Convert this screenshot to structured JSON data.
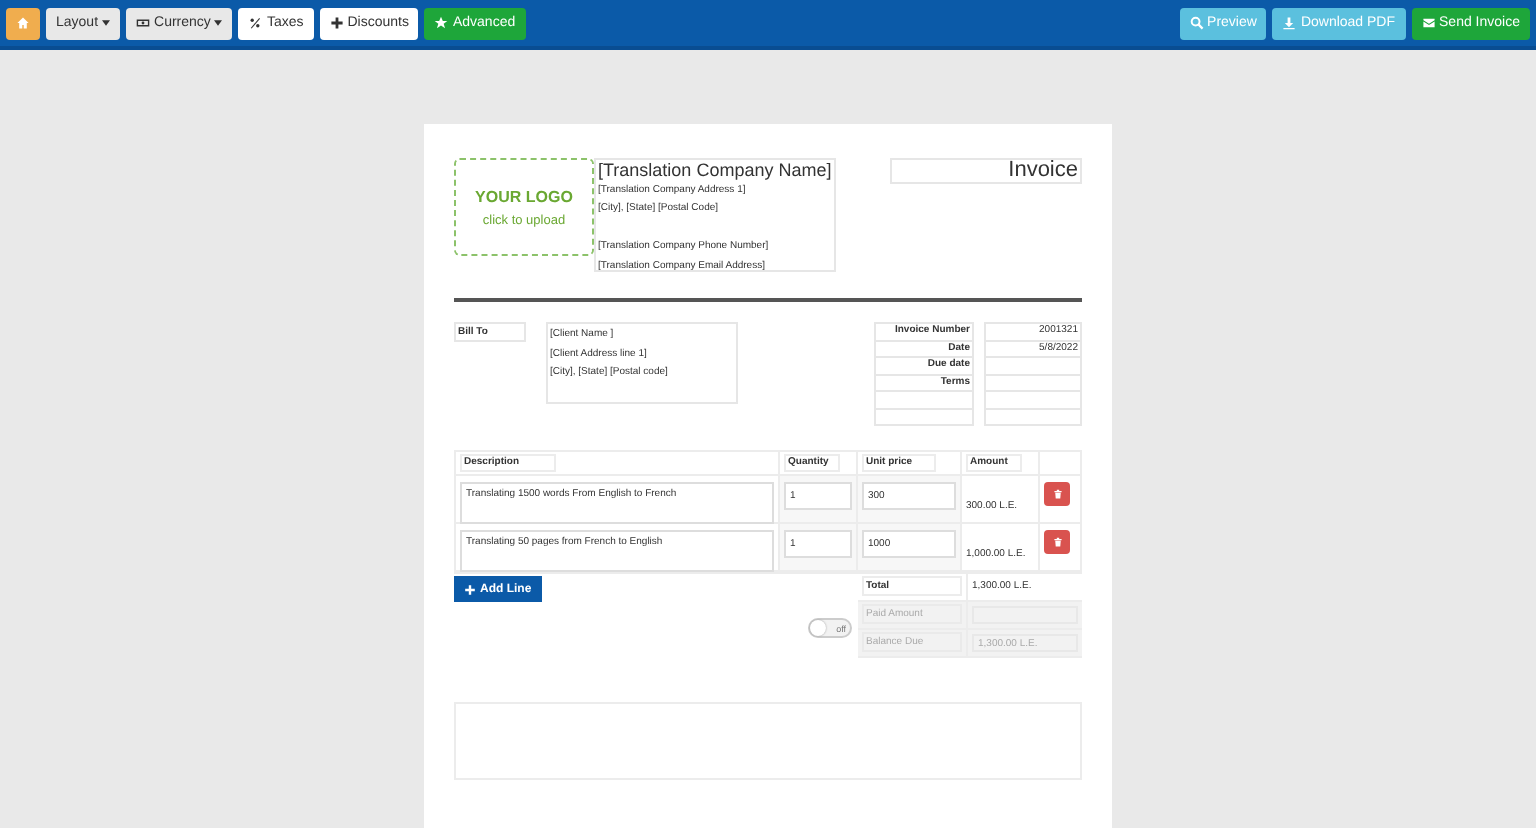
{
  "toolbar": {
    "left": [
      {
        "kind": "home"
      },
      {
        "kind": "layout",
        "label": "Layout"
      },
      {
        "kind": "currency",
        "label": "Currency"
      },
      {
        "kind": "taxes",
        "label": "Taxes"
      },
      {
        "kind": "discounts",
        "label": "Discounts"
      },
      {
        "kind": "advanced",
        "label": "Advanced"
      }
    ],
    "right": [
      {
        "kind": "preview",
        "label": "Preview"
      },
      {
        "kind": "download",
        "label": "Download PDF"
      },
      {
        "kind": "send",
        "label": "Send Invoice"
      }
    ]
  },
  "logo": {
    "title": "YOUR LOGO",
    "hint": "click to upload"
  },
  "company": {
    "name": "[Translation Company Name]",
    "address_lines": [
      "[Translation Company Address 1]",
      "[City], [State] [Postal Code]"
    ],
    "contact_lines": [
      "[Translation Company Phone Number]",
      "[Translation Company Email Address]"
    ]
  },
  "invoice_title": "Invoice",
  "bill_to": {
    "label": "Bill To",
    "lines": [
      "[Client Name ]",
      "[Client Address line 1]",
      "[City], [State] [Postal code]"
    ]
  },
  "meta": [
    {
      "label": "Invoice Number",
      "value": "2001321"
    },
    {
      "label": "Date",
      "value": "5/8/2022"
    },
    {
      "label": "Due date"
    },
    {
      "label": "Terms"
    }
  ],
  "items": {
    "columns": [
      "Description",
      "Quantity",
      "Unit price",
      "Amount"
    ],
    "rows": [
      {
        "description": "Translating 1500 words From English to French",
        "quantity": "1",
        "unit_price": "300",
        "amount": "300.00 L.E."
      },
      {
        "description": "Translating 50 pages from French to English",
        "quantity": "1",
        "unit_price": "1000",
        "amount": "1,000.00 L.E."
      }
    ]
  },
  "add_line": "Add Line",
  "toggle": {
    "label": "off",
    "on": false
  },
  "totals": [
    {
      "label": "Total",
      "value": "1,300.00 L.E.",
      "disabled": false
    },
    {
      "label": "Paid Amount",
      "disabled": true
    },
    {
      "label": "Balance Due",
      "value": "1,300.00 L.E.",
      "disabled": true
    }
  ]
}
